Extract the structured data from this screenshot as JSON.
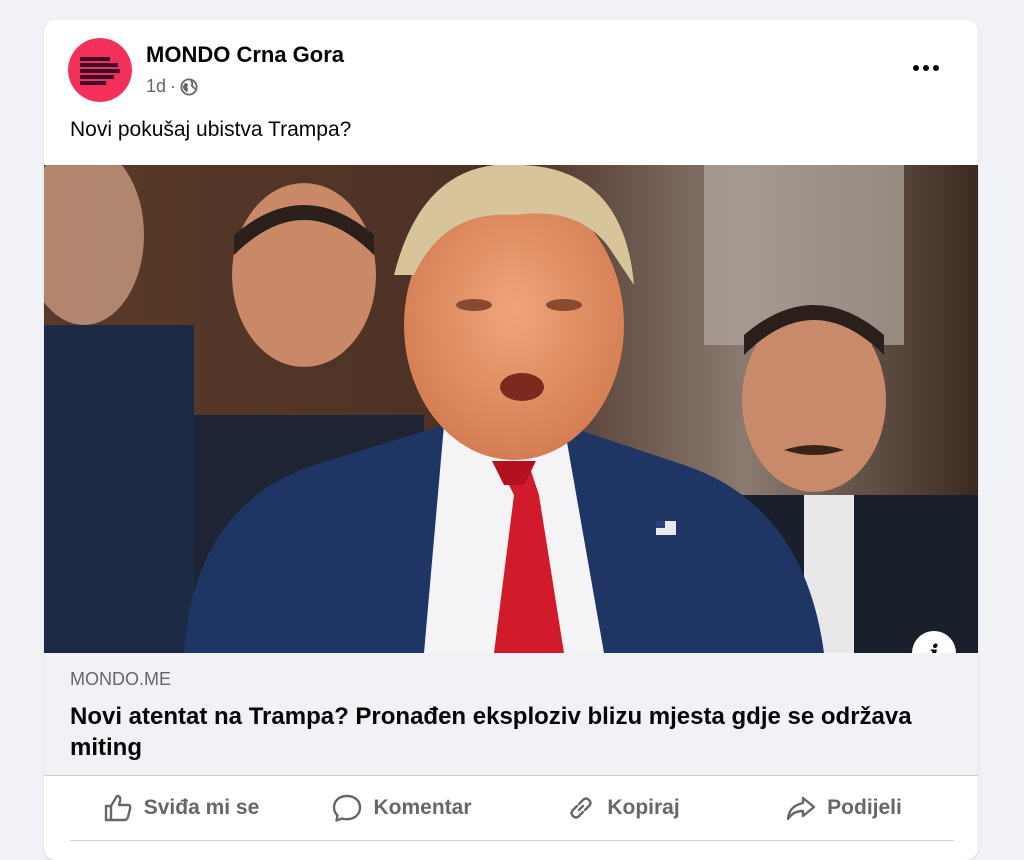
{
  "post": {
    "page_name": "MONDO Crna Gora",
    "time": "1d",
    "separator": "·",
    "audience_icon": "globe-icon",
    "text": "Novi pokušaj ubistva Trampa?",
    "more_icon": "more-options-icon"
  },
  "link_preview": {
    "domain": "MONDO.ME",
    "title": "Novi atentat na Trampa? Pronađen eksploziv blizu mjesta gdje se održava miting",
    "info_label": "i"
  },
  "actions": [
    {
      "label": "Sviđa mi se",
      "icon": "thumbs-up-icon"
    },
    {
      "label": "Komentar",
      "icon": "comment-icon"
    },
    {
      "label": "Kopiraj",
      "icon": "link-icon"
    },
    {
      "label": "Podijeli",
      "icon": "share-icon"
    }
  ],
  "colors": {
    "avatar_bg": "#f2305a",
    "avatar_bars": "#3b0d2a",
    "muted_text": "#65676b",
    "page_bg": "#f0f2f5",
    "tie": "#d11a2a",
    "suit": "#1f3563"
  }
}
